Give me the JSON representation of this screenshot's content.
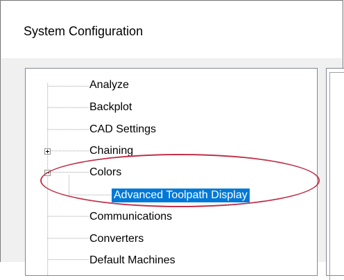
{
  "window": {
    "title": "System Configuration"
  },
  "tree": {
    "items": [
      {
        "label": "Analyze",
        "level": 0,
        "expander": "none"
      },
      {
        "label": "Backplot",
        "level": 0,
        "expander": "none"
      },
      {
        "label": "CAD Settings",
        "level": 0,
        "expander": "none"
      },
      {
        "label": "Chaining",
        "level": 0,
        "expander": "plus"
      },
      {
        "label": "Colors",
        "level": 0,
        "expander": "minus"
      },
      {
        "label": "Advanced Toolpath Display",
        "level": 1,
        "expander": "none",
        "selected": true
      },
      {
        "label": "Communications",
        "level": 0,
        "expander": "none"
      },
      {
        "label": "Converters",
        "level": 0,
        "expander": "none"
      },
      {
        "label": "Default Machines",
        "level": 0,
        "expander": "none"
      }
    ]
  },
  "colors": {
    "selection": "#0078d7",
    "annotation": "#c0304a"
  }
}
